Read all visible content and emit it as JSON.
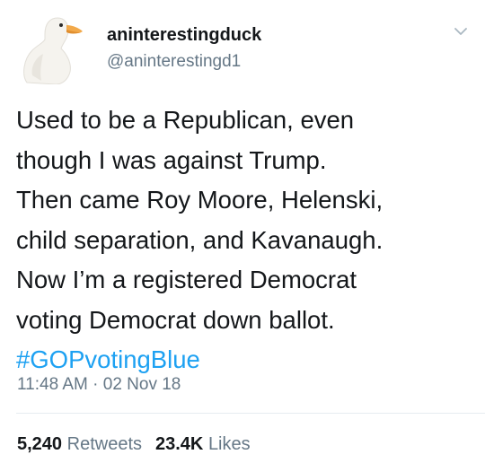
{
  "user": {
    "display_name": "aninterestingduck",
    "handle": "@aninterestingd1",
    "avatar_icon": "white-duck-avatar"
  },
  "tweet": {
    "lines": [
      "Used to be a Republican, even",
      "though I was against Trump.",
      "Then came Roy Moore, Helenski,",
      "child separation, and Kavanaugh.",
      "Now I’m a registered Democrat",
      "voting Democrat down ballot."
    ],
    "hashtag": "#GOPvotingBlue",
    "time": "11:48 AM",
    "separator": " · ",
    "date": "02 Nov 18"
  },
  "stats": {
    "retweets_count": "5,240",
    "retweets_label": "Retweets",
    "likes_count": "23.4K",
    "likes_label": "Likes"
  },
  "colors": {
    "text": "#14171a",
    "secondary": "#657786",
    "link": "#1da1f2",
    "divider": "#e6ecf0"
  },
  "icons": {
    "menu": "chevron-down-icon"
  }
}
